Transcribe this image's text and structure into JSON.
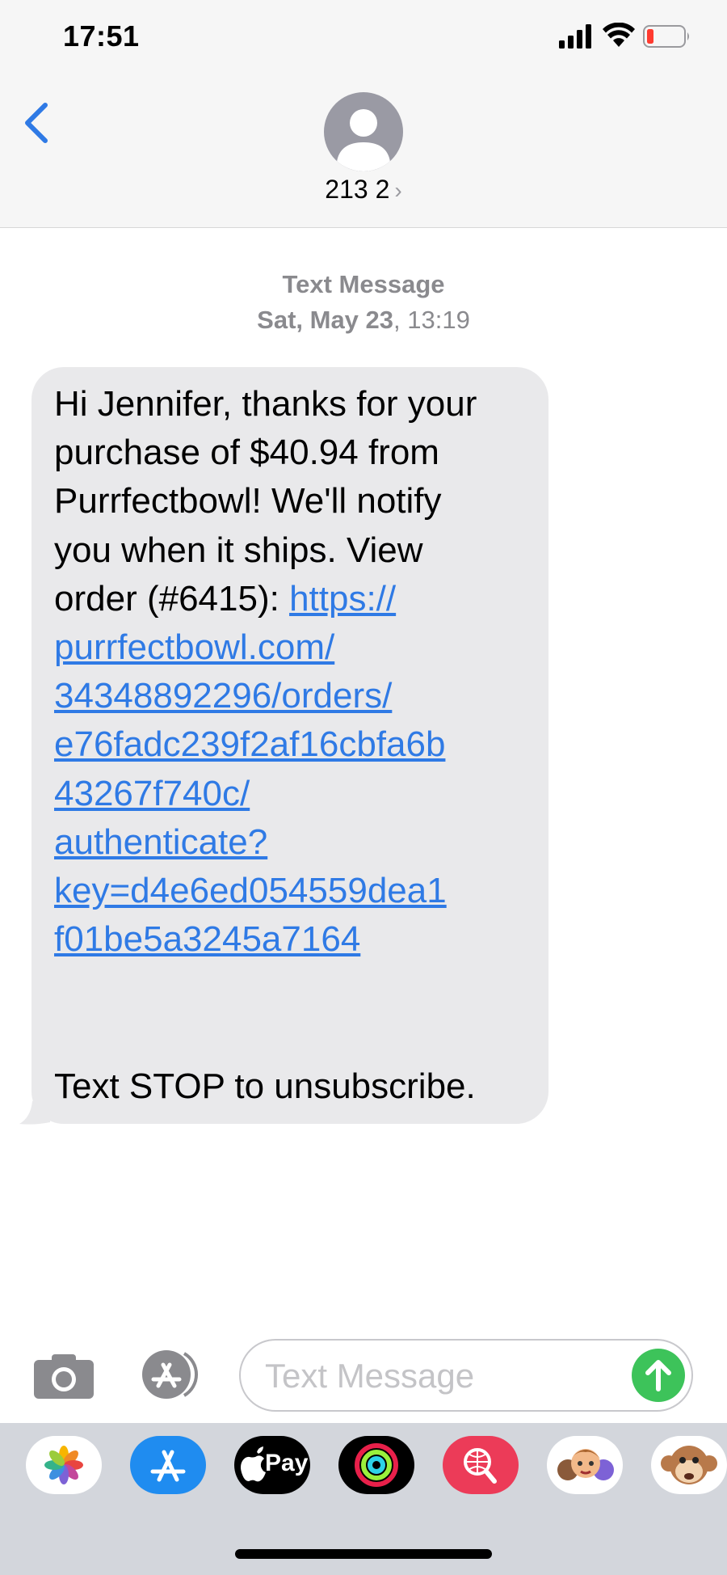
{
  "status_bar": {
    "time": "17:51"
  },
  "header": {
    "contact_name": "213 2",
    "chevron": "›"
  },
  "conversation": {
    "message_kind": "Text Message",
    "date_day": "Sat, May 23",
    "date_time": ", 13:19",
    "message": {
      "text_lines": [
        "Hi Jennifer, thanks for your",
        "purchase of $40.94 from",
        "Purrfectbowl! We'll notify",
        "you when it ships. View"
      ],
      "order_prefix": "order (#6415): ",
      "link_lines": [
        "https://",
        "purrfectbowl.com/",
        "34348892296/orders/",
        "e76fadc239f2af16cbfa6b",
        "43267f740c/",
        "authenticate?",
        "key=d4e6ed054559dea1",
        "f01be5a3245a7164"
      ],
      "footer": "Text STOP to unsubscribe."
    }
  },
  "composer": {
    "placeholder": "Text Message"
  },
  "app_drawer": {
    "apple_pay_label": "Pay"
  },
  "icons": [
    "back-chevron-icon",
    "contact-avatar-icon",
    "camera-icon",
    "app-store-icon",
    "send-arrow-icon",
    "photos-icon",
    "apple-pay-icon",
    "activity-icon",
    "web-search-icon",
    "memoji-icon",
    "monkey-animoji-icon"
  ],
  "colors": {
    "link": "#2f7ae5",
    "bubble": "#e9e9eb",
    "send": "#3dc35a",
    "ios_blue": "#2f7ae5"
  }
}
